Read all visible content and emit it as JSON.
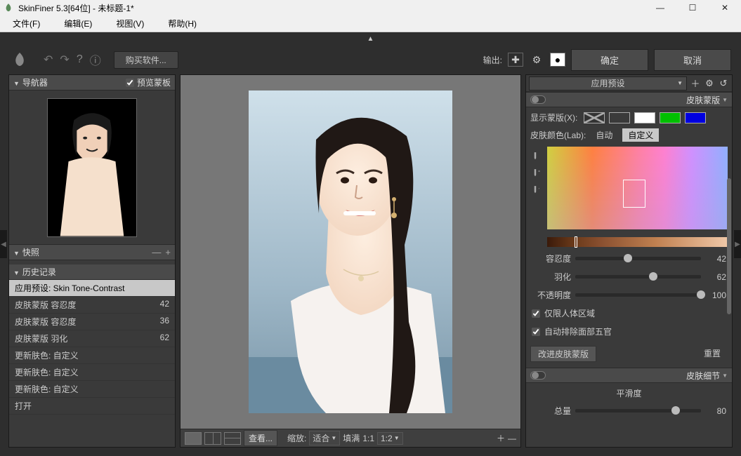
{
  "titlebar": {
    "title": "SkinFiner 5.3[64位] - 未标题-1*"
  },
  "menubar": {
    "file": "文件(F)",
    "edit": "编辑(E)",
    "view": "视图(V)",
    "help": "帮助(H)"
  },
  "toolbar": {
    "buy": "购买软件...",
    "output_label": "输出:",
    "ok": "确定",
    "cancel": "取消"
  },
  "left": {
    "navigator": {
      "title": "导航器",
      "preview_mask": "预览蒙板"
    },
    "snapshot": {
      "title": "快照"
    },
    "history": {
      "title": "历史记录",
      "items": [
        {
          "label": "应用预设: Skin Tone-Contrast",
          "val": ""
        },
        {
          "label": "皮肤蒙版 容忍度",
          "val": "42"
        },
        {
          "label": "皮肤蒙版 容忍度",
          "val": "36"
        },
        {
          "label": "皮肤蒙版 羽化",
          "val": "62"
        },
        {
          "label": "更新肤色: 自定义",
          "val": ""
        },
        {
          "label": "更新肤色: 自定义",
          "val": ""
        },
        {
          "label": "更新肤色: 自定义",
          "val": ""
        },
        {
          "label": "打开",
          "val": ""
        }
      ]
    }
  },
  "canvas": {
    "footer": {
      "view_btn": "查看...",
      "zoom_label": "缩放:",
      "fit": "适合",
      "fill": "填满",
      "z11": "1:1",
      "z12": "1:2"
    }
  },
  "right": {
    "preset": {
      "label": "应用预设"
    },
    "skin_mask": {
      "title": "皮肤蒙版",
      "show_mask": "显示蒙版(X):",
      "skin_color": "皮肤颜色(Lab):",
      "auto": "自动",
      "custom": "自定义",
      "tolerance": {
        "label": "容忍度",
        "value": "42",
        "pct": 42
      },
      "feather": {
        "label": "羽化",
        "value": "62",
        "pct": 62
      },
      "opacity": {
        "label": "不透明度",
        "value": "100",
        "pct": 100
      },
      "limit_body": "仅限人体区域",
      "exclude_features": "自动排除面部五官",
      "improve": "改进皮肤蒙版",
      "reset": "重置",
      "swatches": {
        "black": "#000000",
        "white": "#ffffff",
        "green": "#00c000",
        "blue": "#0000e0"
      }
    },
    "skin_detail": {
      "title": "皮肤细节",
      "smoothness": {
        "label": "平滑度"
      },
      "total": {
        "label": "总量",
        "value": "80",
        "pct": 80
      }
    }
  }
}
